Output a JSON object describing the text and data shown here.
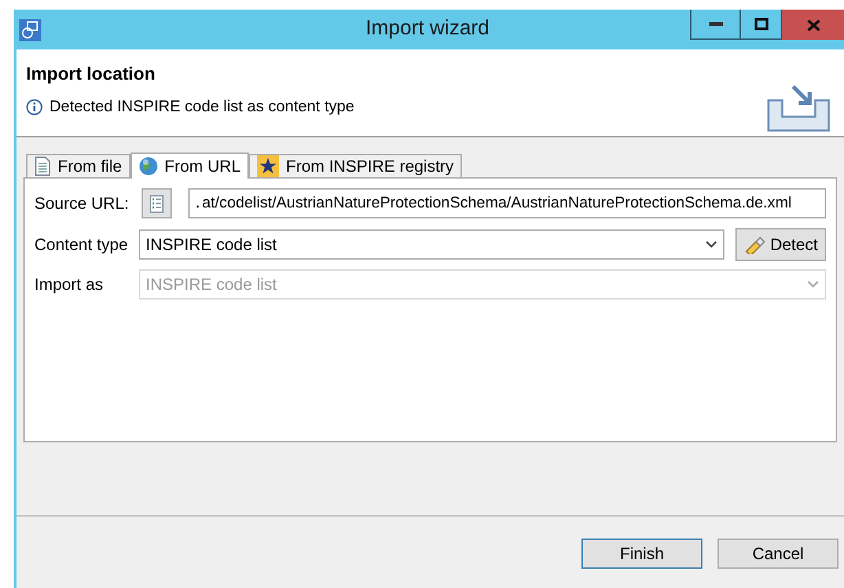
{
  "window": {
    "title": "Import wizard"
  },
  "header": {
    "title": "Import location",
    "message": "Detected INSPIRE code list as content type"
  },
  "tabs": [
    {
      "label": "From file",
      "kind": "file",
      "selected": false
    },
    {
      "label": "From URL",
      "kind": "url",
      "selected": true
    },
    {
      "label": "From INSPIRE registry",
      "kind": "registry",
      "selected": false
    }
  ],
  "form": {
    "source_url": {
      "label": "Source URL:",
      "value": "․at/codelist/AustrianNatureProtectionSchema/AustrianNatureProtectionSchema.de.xml"
    },
    "content_type": {
      "label": "Content type",
      "value": "INSPIRE code list",
      "disabled": false,
      "action": "Detect"
    },
    "import_as": {
      "label": "Import as",
      "value": "INSPIRE code list",
      "disabled": true
    }
  },
  "buttons": [
    "Finish",
    "Cancel"
  ]
}
